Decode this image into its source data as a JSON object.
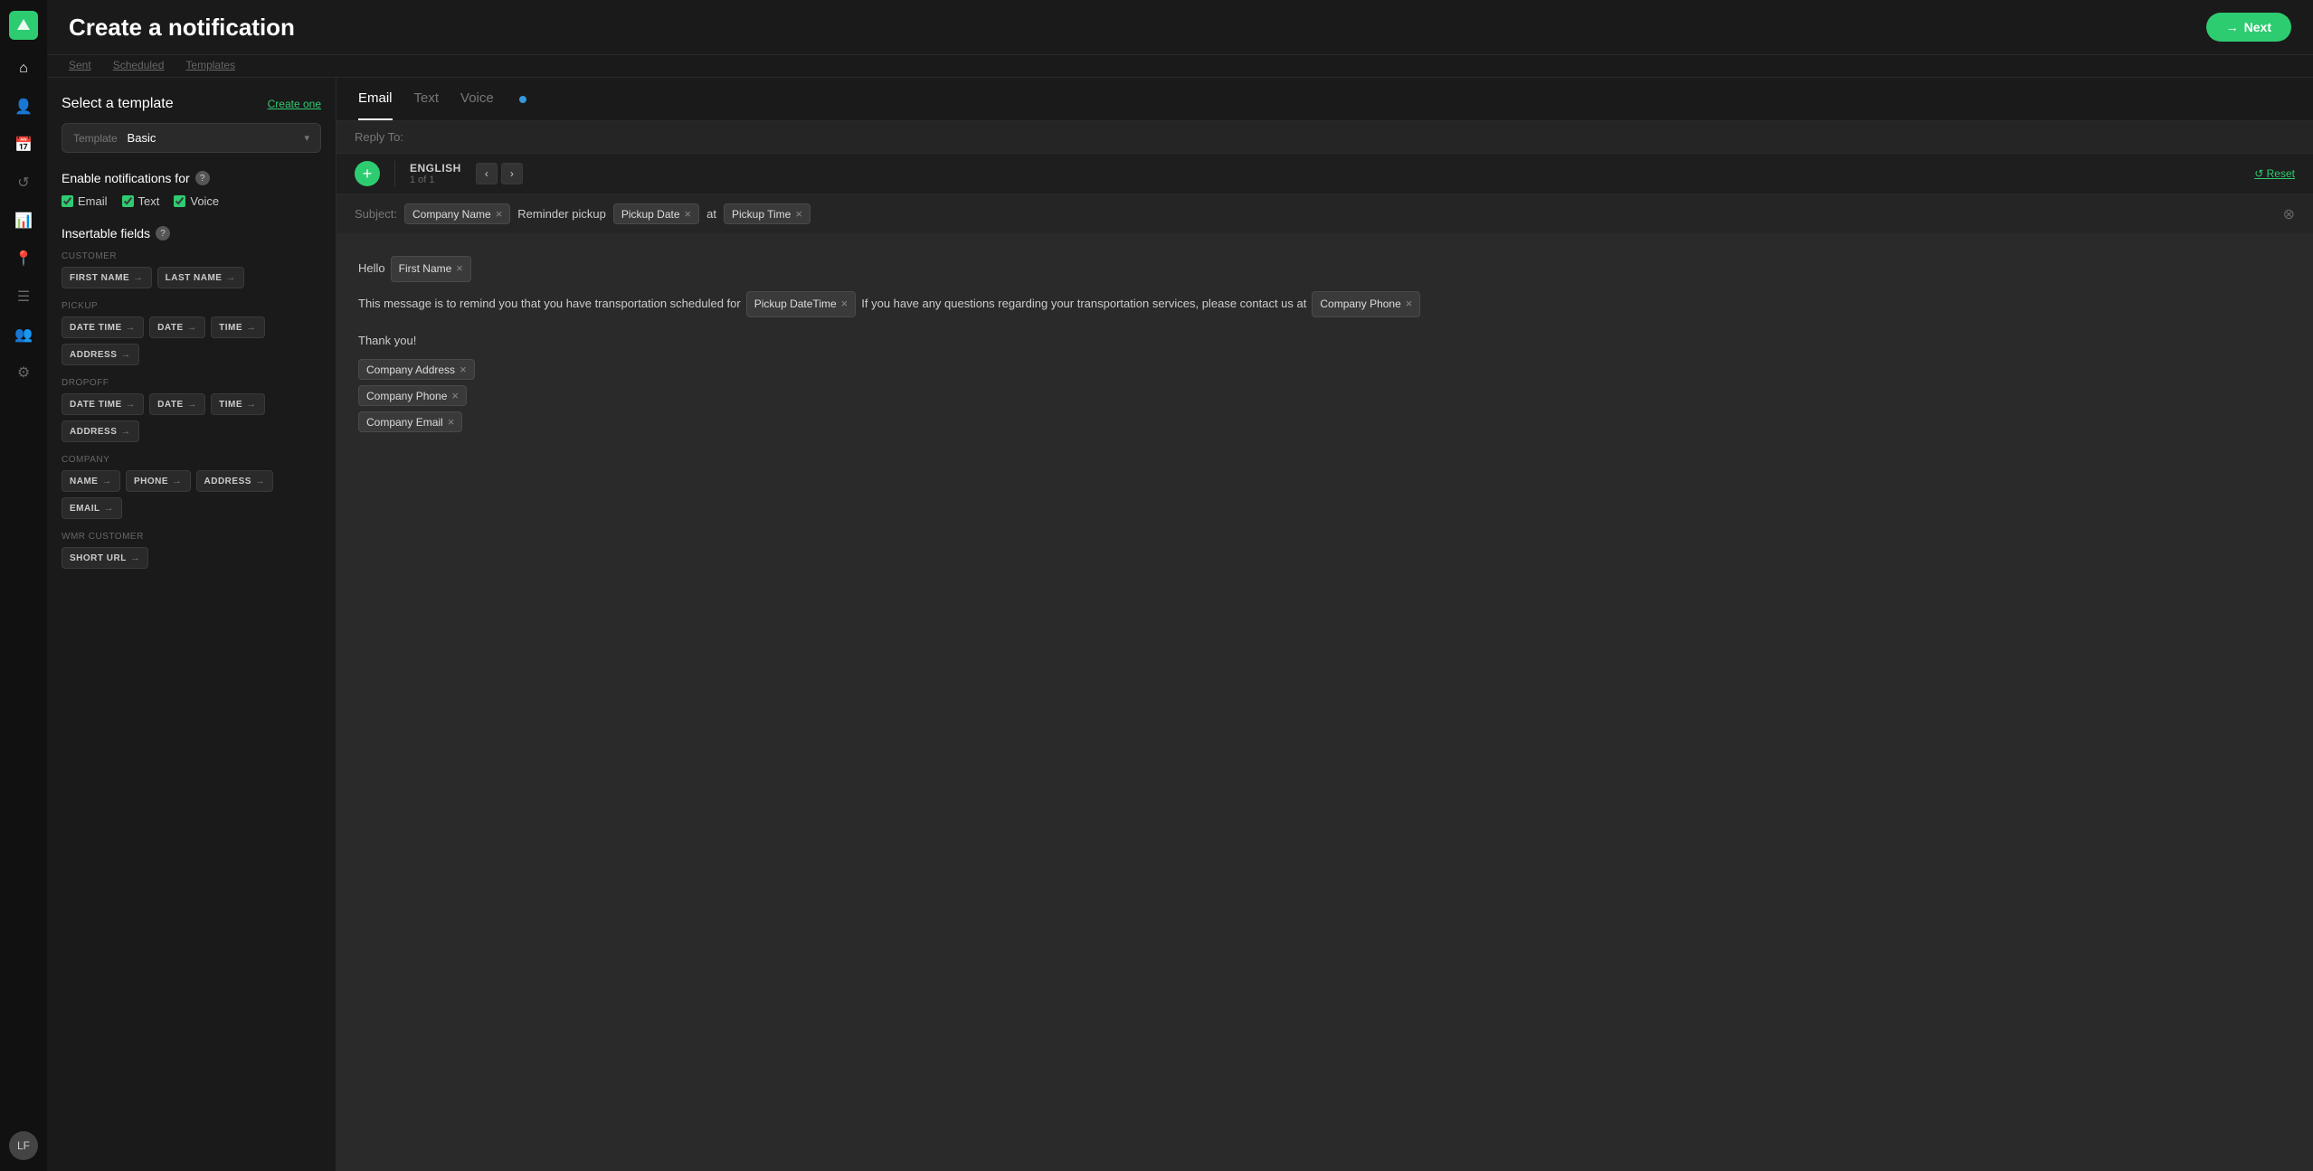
{
  "app": {
    "logo": "●",
    "title": "Create a notification"
  },
  "nav": {
    "items": [
      {
        "name": "home",
        "icon": "⌂"
      },
      {
        "name": "contacts",
        "icon": "👤"
      },
      {
        "name": "calendar",
        "icon": "📅"
      },
      {
        "name": "history",
        "icon": "↺"
      },
      {
        "name": "chart",
        "icon": "📊"
      },
      {
        "name": "location",
        "icon": "📍"
      },
      {
        "name": "list",
        "icon": "☰"
      },
      {
        "name": "team",
        "icon": "👥"
      },
      {
        "name": "settings",
        "icon": "⚙"
      }
    ],
    "avatar": "LF"
  },
  "subnav": {
    "links": [
      "Sent",
      "Scheduled",
      "Templates"
    ]
  },
  "topbar": {
    "next_button": "Next",
    "next_arrow": "→"
  },
  "tabs": {
    "items": [
      "Email",
      "Text",
      "Voice"
    ],
    "active": "Email",
    "info_dot": true
  },
  "reply_to": {
    "label": "Reply To:"
  },
  "language": {
    "add": "+",
    "name": "ENGLISH",
    "count": "1 of 1",
    "prev": "‹",
    "next": "›",
    "reset": "↺ Reset"
  },
  "subject": {
    "label": "Subject:",
    "chips": [
      {
        "text": "Company Name",
        "removable": true
      },
      {
        "text": "Reminder pickup",
        "removable": false
      },
      {
        "text": "Pickup Date",
        "removable": true
      },
      {
        "text": "at",
        "removable": false
      },
      {
        "text": "Pickup Time",
        "removable": true
      }
    ]
  },
  "email_body": {
    "hello_prefix": "Hello",
    "first_name_chip": "First Name",
    "message_prefix": "This message is to remind you that you have transportation scheduled for",
    "pickup_datetime_chip": "Pickup DateTime",
    "message_suffix": "If you have any questions regarding your transportation services, please contact us at",
    "company_phone_chip": "Company Phone",
    "thank_you": "Thank you!",
    "footer_chips": [
      {
        "text": "Company Address",
        "removable": true
      },
      {
        "text": "Company Phone",
        "removable": true
      },
      {
        "text": "Company Email",
        "removable": true
      }
    ]
  },
  "sidebar": {
    "template_section": {
      "title": "Select a template",
      "create_one": "Create one",
      "template_label": "Template",
      "template_value": "Basic",
      "chevron": "▾"
    },
    "enable_section": {
      "title": "Enable notifications for",
      "checkboxes": [
        {
          "label": "Email",
          "checked": true
        },
        {
          "label": "Text",
          "checked": true
        },
        {
          "label": "Voice",
          "checked": true
        }
      ]
    },
    "insertable": {
      "title": "Insertable fields",
      "groups": [
        {
          "label": "CUSTOMER",
          "fields": [
            {
              "text": "FIRST NAME",
              "arrow": "→"
            },
            {
              "text": "LAST NAME",
              "arrow": "→"
            }
          ]
        },
        {
          "label": "PICKUP",
          "fields": [
            {
              "text": "DATE TIME",
              "arrow": "→"
            },
            {
              "text": "DATE",
              "arrow": "→"
            },
            {
              "text": "TIME",
              "arrow": "→"
            },
            {
              "text": "ADDRESS",
              "arrow": "→"
            }
          ]
        },
        {
          "label": "DROPOFF",
          "fields": [
            {
              "text": "DATE TIME",
              "arrow": "→"
            },
            {
              "text": "DATE",
              "arrow": "→"
            },
            {
              "text": "TIME",
              "arrow": "→"
            },
            {
              "text": "ADDRESS",
              "arrow": "→"
            }
          ]
        },
        {
          "label": "COMPANY",
          "fields": [
            {
              "text": "NAME",
              "arrow": "→"
            },
            {
              "text": "PHONE",
              "arrow": "→"
            },
            {
              "text": "ADDRESS",
              "arrow": "→"
            },
            {
              "text": "EMAIL",
              "arrow": "→"
            }
          ]
        },
        {
          "label": "WMR CUSTOMER",
          "fields": [
            {
              "text": "SHORT URL",
              "arrow": "→"
            }
          ]
        }
      ]
    }
  }
}
